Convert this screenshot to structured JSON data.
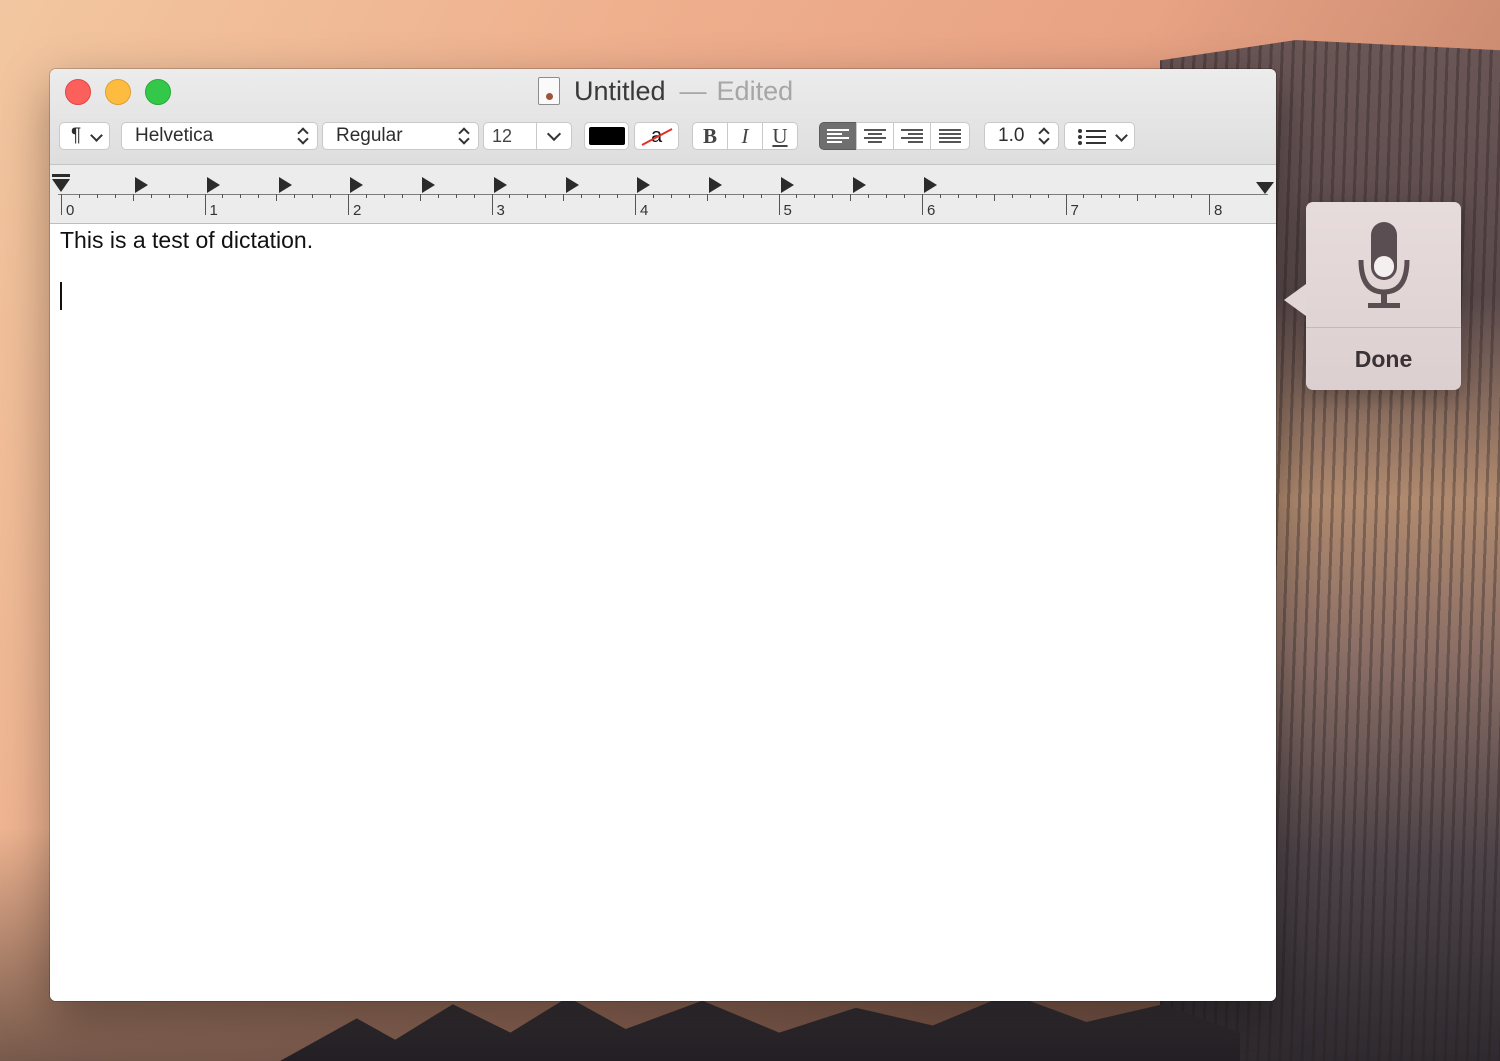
{
  "window": {
    "title": "Untitled",
    "separator": "—",
    "status": "Edited"
  },
  "toolbar": {
    "paragraph_symbol": "¶",
    "font_family": "Helvetica",
    "font_style": "Regular",
    "font_size": "12",
    "text_color": "#000000",
    "highlight_label": "a",
    "bold_label": "B",
    "italic_label": "I",
    "underline_label": "U",
    "alignment_selected": "left",
    "line_spacing": "1.0",
    "list_icon": "bullet-list-icon"
  },
  "ruler": {
    "numbers": [
      "0",
      "1",
      "2",
      "3",
      "4",
      "5",
      "6",
      "7",
      "8"
    ]
  },
  "document": {
    "lines": [
      "This is a test of dictation.",
      ""
    ]
  },
  "dictation": {
    "icon": "microphone-icon",
    "done_label": "Done"
  }
}
